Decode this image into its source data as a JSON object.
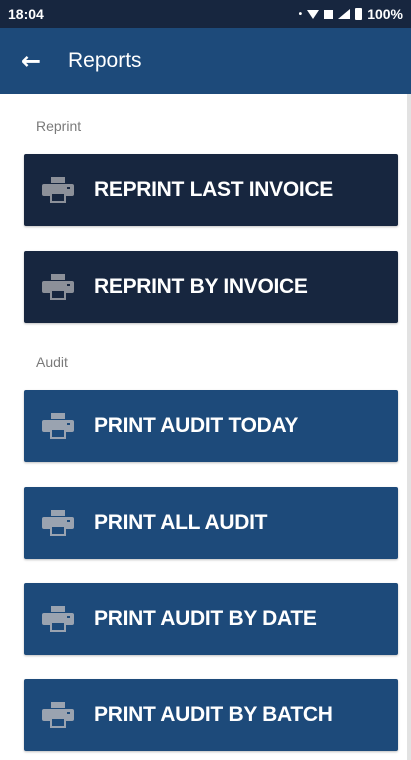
{
  "status_bar": {
    "time": "18:04",
    "battery": "100%"
  },
  "app_bar": {
    "title": "Reports",
    "back_icon": "arrow-back-icon"
  },
  "sections": {
    "reprint": {
      "label": "Reprint",
      "buttons": [
        {
          "label": "REPRINT LAST INVOICE",
          "icon": "printer-icon"
        },
        {
          "label": "REPRINT BY INVOICE",
          "icon": "printer-icon"
        }
      ]
    },
    "audit": {
      "label": "Audit",
      "buttons": [
        {
          "label": "PRINT AUDIT TODAY",
          "icon": "printer-icon"
        },
        {
          "label": "PRINT ALL AUDIT",
          "icon": "printer-icon"
        },
        {
          "label": "PRINT AUDIT BY DATE",
          "icon": "printer-icon"
        },
        {
          "label": "PRINT AUDIT BY BATCH",
          "icon": "printer-icon"
        }
      ]
    }
  },
  "colors": {
    "status_bar": "#17263f",
    "app_bar": "#1d4a7a",
    "reprint_button": "#17263f",
    "audit_button": "#1d4a7a"
  }
}
